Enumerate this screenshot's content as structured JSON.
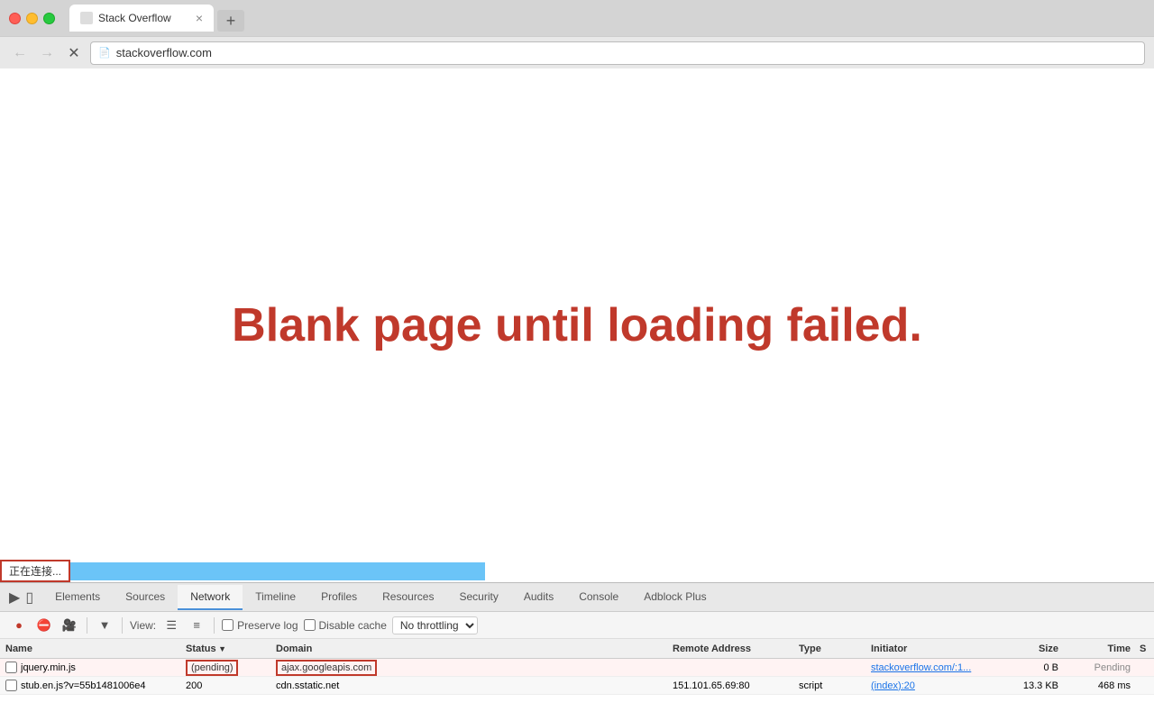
{
  "browser": {
    "traffic_lights": [
      "red",
      "yellow",
      "green"
    ],
    "tab": {
      "title": "Stack Overflow",
      "favicon": "📄",
      "close": "×"
    },
    "new_tab_label": "+",
    "nav": {
      "back": "←",
      "forward": "→",
      "stop": "✕",
      "address": "stackoverflow.com"
    }
  },
  "page": {
    "main_message": "Blank page until loading failed.",
    "status_text": "正在连接...",
    "progress_width": 460
  },
  "devtools": {
    "tabs": [
      "Elements",
      "Sources",
      "Network",
      "Timeline",
      "Profiles",
      "Resources",
      "Security",
      "Audits",
      "Console",
      "Adblock Plus"
    ],
    "active_tab": "Network",
    "toolbar": {
      "record_tooltip": "Record",
      "stop_tooltip": "Stop",
      "camera_tooltip": "Screenshot",
      "filter_tooltip": "Filter",
      "view_label": "View:",
      "list_view": "list",
      "detail_view": "detail",
      "preserve_log_label": "Preserve log",
      "disable_cache_label": "Disable cache",
      "throttle_label": "No throttling",
      "throttle_arrow": "▼"
    },
    "table": {
      "columns": [
        "Name",
        "Status",
        "Domain",
        "",
        "Remote Address",
        "Type",
        "Initiator",
        "Size",
        "Time",
        "S"
      ],
      "rows": [
        {
          "name": "jquery.min.js",
          "status": "(pending)",
          "domain": "ajax.googleapis.com",
          "remote_address": "",
          "type": "",
          "initiator": "stackoverflow.com/:1...",
          "size": "0 B",
          "time": "Pending",
          "s": "",
          "highlighted": true
        },
        {
          "name": "stub.en.js?v=55b1481006e4",
          "status": "200",
          "domain": "cdn.sstatic.net",
          "remote_address": "151.101.65.69:80",
          "type": "script",
          "initiator": "(index):20",
          "size": "13.3 KB",
          "time": "468 ms",
          "s": "",
          "highlighted": false
        }
      ]
    }
  }
}
